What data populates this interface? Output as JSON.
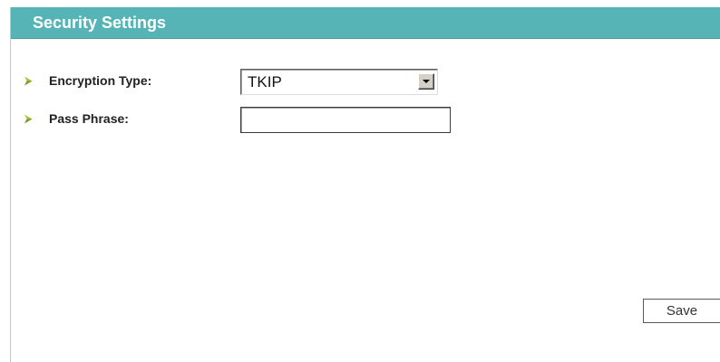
{
  "header": {
    "title": "Security Settings",
    "color": "#56b4b7"
  },
  "form": {
    "encryption_type": {
      "label": "Encryption Type:",
      "selected": "TKIP",
      "icon": "chevron-right-icon"
    },
    "pass_phrase": {
      "label": "Pass Phrase:",
      "value": "",
      "icon": "chevron-right-icon"
    }
  },
  "actions": {
    "save_label": "Save"
  },
  "colors": {
    "accent": "#56b4b7",
    "bullet": "#a6c93c"
  }
}
